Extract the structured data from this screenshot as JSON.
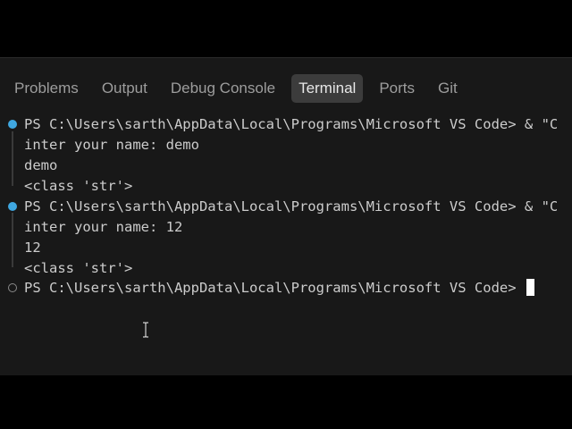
{
  "panel_tabs": [
    {
      "label": "Problems",
      "active": false
    },
    {
      "label": "Output",
      "active": false
    },
    {
      "label": "Debug Console",
      "active": false
    },
    {
      "label": "Terminal",
      "active": true
    },
    {
      "label": "Ports",
      "active": false
    },
    {
      "label": "Git",
      "active": false
    }
  ],
  "terminal": {
    "lines": [
      {
        "text": "PS C:\\Users\\sarth\\AppData\\Local\\Programs\\Microsoft VS Code> & \"C",
        "type": "prompt",
        "marker": "success"
      },
      {
        "text": "inter your name: demo",
        "type": "output"
      },
      {
        "text": "demo",
        "type": "output"
      },
      {
        "text": "<class 'str'>",
        "type": "output"
      },
      {
        "text": "PS C:\\Users\\sarth\\AppData\\Local\\Programs\\Microsoft VS Code> & \"C",
        "type": "prompt",
        "marker": "success"
      },
      {
        "text": "inter your name: 12",
        "type": "output"
      },
      {
        "text": "12",
        "type": "output"
      },
      {
        "text": "<class 'str'>",
        "type": "output"
      },
      {
        "text": "PS C:\\Users\\sarth\\AppData\\Local\\Programs\\Microsoft VS Code> ",
        "type": "prompt",
        "marker": "idle",
        "cursor": true
      }
    ]
  },
  "colors": {
    "panel_background": "#181818",
    "active_tab_background": "#3c3c3c",
    "text": "#cccccc",
    "success_marker": "#3fa7e0",
    "idle_marker": "#8a8a8a"
  }
}
